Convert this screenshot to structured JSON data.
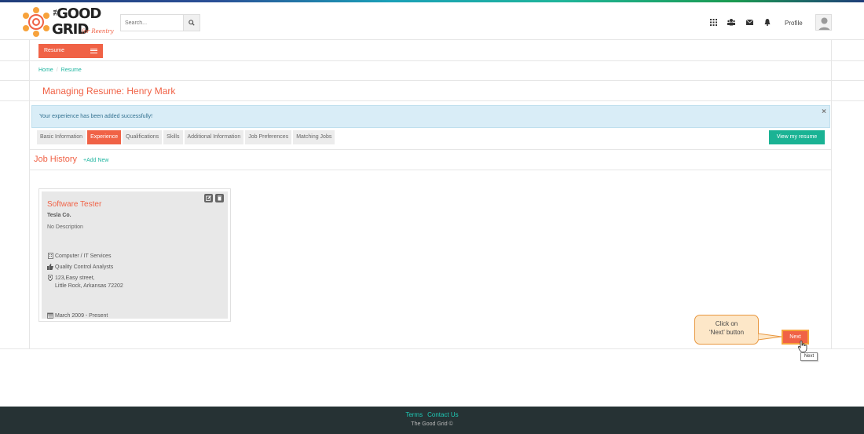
{
  "brand": {
    "logo_line1": "THE",
    "logo_word1": "GOOD",
    "logo_word2": "GRID",
    "logo_tagline": "for Reentry",
    "accent_color": "#f06246",
    "teal_color": "#1ab394"
  },
  "header": {
    "search_placeholder": "Search...",
    "profile_label": "Profile",
    "icons": [
      "apps-grid-icon",
      "users-icon",
      "envelope-icon",
      "bell-icon"
    ]
  },
  "nav": {
    "resume_button": "Resume"
  },
  "breadcrumb": {
    "home": "Home",
    "separator": "/",
    "current": "Resume"
  },
  "page": {
    "title": "Managing Resume: Henry Mark"
  },
  "alert": {
    "message": "Your experience has been added successfully!",
    "close": "×"
  },
  "tabs": [
    {
      "label": "Basic Information",
      "active": false
    },
    {
      "label": "Experience",
      "active": true
    },
    {
      "label": "Qualifications",
      "active": false
    },
    {
      "label": "Skills",
      "active": false
    },
    {
      "label": "Additional Information",
      "active": false
    },
    {
      "label": "Job Preferences",
      "active": false
    },
    {
      "label": "Matching Jobs",
      "active": false
    }
  ],
  "view_resume_button": "View my resume",
  "section": {
    "title": "Job History",
    "add_new": "+Add New"
  },
  "job": {
    "title": "Software Tester",
    "company": "Tesla Co.",
    "description": "No Description",
    "industry": "Computer / IT Services",
    "role": "Quality Control Analysts",
    "address_line1": "123,Easy street,",
    "address_line2": "Little Rock, Arkansas 72202",
    "dates": "March 2009 -  Present"
  },
  "callout": {
    "line1": "Click on",
    "line2": "‘Next’ button"
  },
  "next_button": "Next",
  "tooltip": "Next",
  "footer": {
    "terms": "Terms",
    "contact": "Contact Us",
    "copyright": "The Good Grid ©"
  }
}
